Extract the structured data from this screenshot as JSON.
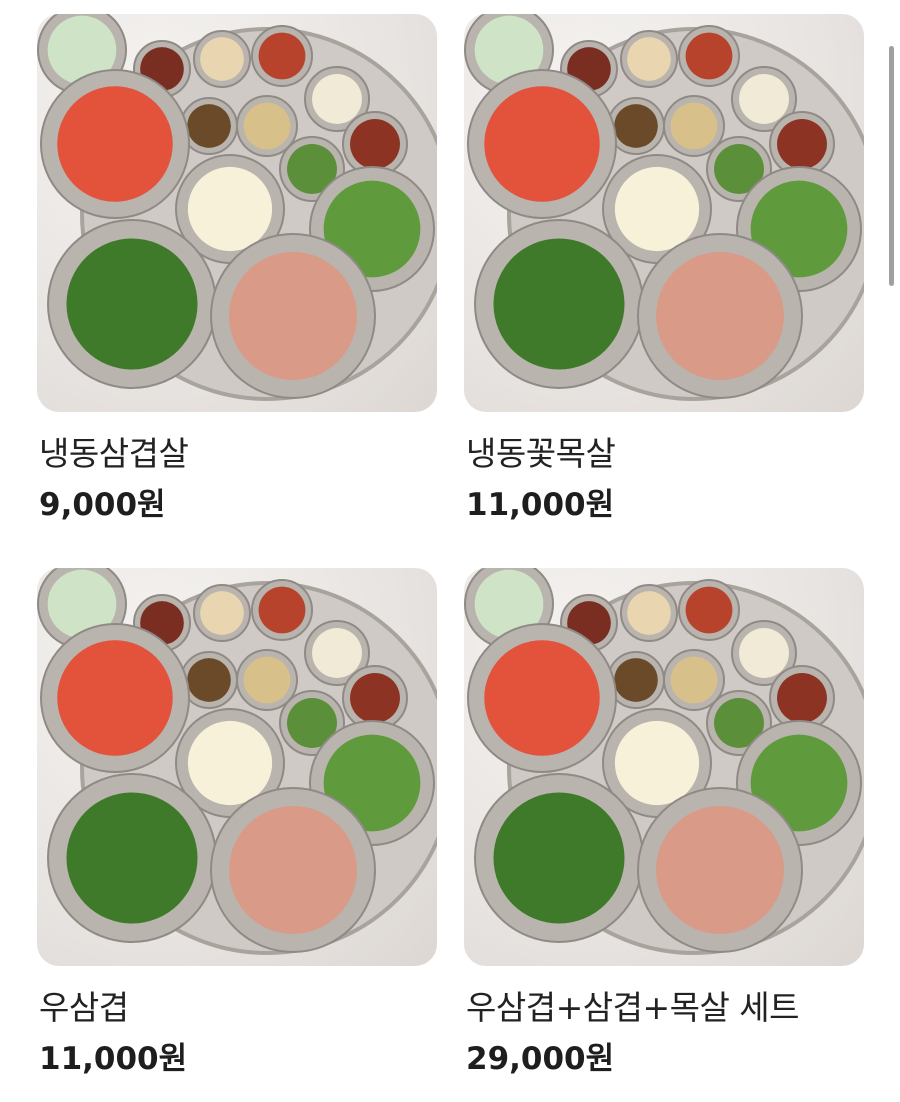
{
  "menu": {
    "items": [
      {
        "name": "냉동삼겹살",
        "price": "9,000원",
        "image_alt": "반찬 상차림"
      },
      {
        "name": "냉동꽃목살",
        "price": "11,000원",
        "image_alt": "반찬 상차림"
      },
      {
        "name": "우삼겹",
        "price": "11,000원",
        "image_alt": "반찬 상차림"
      },
      {
        "name": "우삼겹+삼겹+목살 세트",
        "price": "29,000원",
        "image_alt": "반찬 상차림"
      }
    ]
  },
  "colors": {
    "background": "#ffffff",
    "text": "#1a1a1a",
    "thumbnail_bg": "#e8e4e1"
  }
}
